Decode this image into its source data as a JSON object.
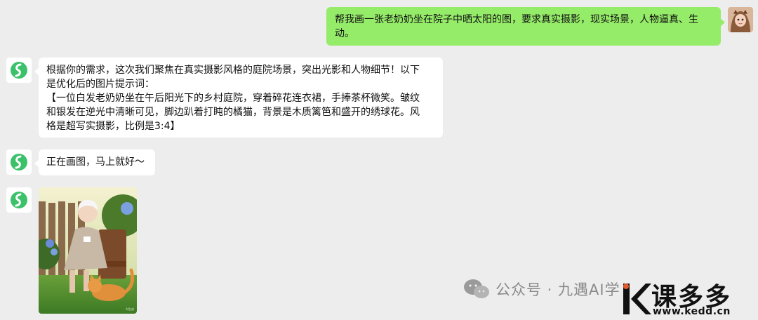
{
  "conversation": {
    "user_message": "帮我画一张老奶奶坐在院子中晒太阳的图，要求真实摄影，现实场景，人物逼真、生动。",
    "bot_reply_lines": [
      "根据你的需求，这次我们聚焦在真实摄影风格的庭院场景，突出光影和人物细节！以下",
      "是优化后的图片提示词：",
      "【一位白发老奶奶坐在午后阳光下的乡村庭院，穿着碎花连衣裙，手捧茶杯微笑。皱纹",
      "和银发在逆光中清晰可见，脚边趴着打盹的橘猫，背景是木质篱笆和盛开的绣球花。风",
      "格是超写实摄影，比例是3:4】"
    ],
    "bot_status": "正在画图，马上就好～",
    "generated_image": {
      "icon": "generated-photo",
      "caption": "AI生成"
    }
  },
  "watermark": {
    "channel_text": "公众号 · 九遇AI学",
    "brand_name": "课多多",
    "brand_url": "www.kedd.cn"
  },
  "colors": {
    "background": "#ededed",
    "user_bubble": "#95ec69",
    "bot_bubble": "#ffffff",
    "bot_logo": "#3cc16b"
  }
}
